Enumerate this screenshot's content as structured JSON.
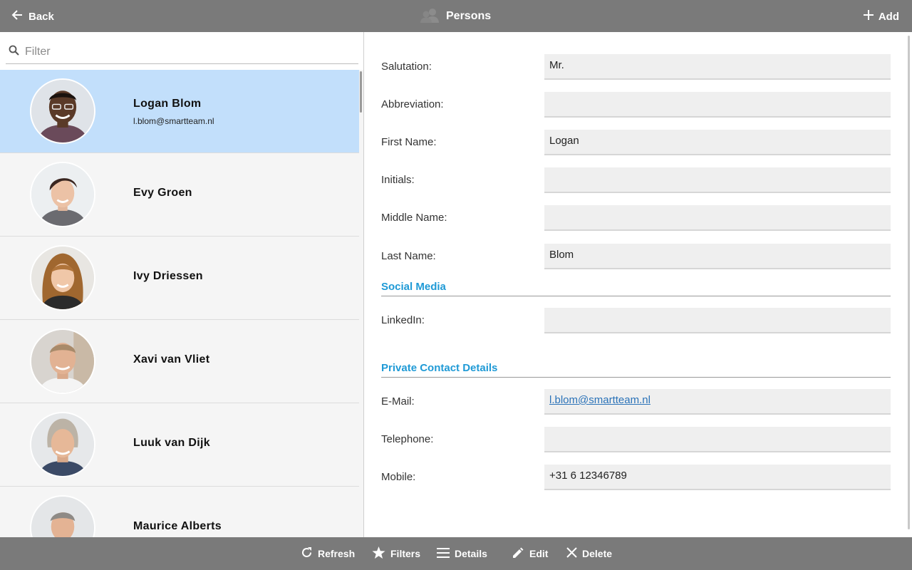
{
  "header": {
    "back_label": "Back",
    "title": "Persons",
    "add_label": "Add"
  },
  "filter": {
    "placeholder": "Filter",
    "value": ""
  },
  "persons": [
    {
      "name": "Logan Blom",
      "email": "l.blom@smartteam.nl",
      "selected": true
    },
    {
      "name": "Evy Groen",
      "email": "",
      "selected": false
    },
    {
      "name": "Ivy Driessen",
      "email": "",
      "selected": false
    },
    {
      "name": "Xavi van Vliet",
      "email": "",
      "selected": false
    },
    {
      "name": "Luuk van Dijk",
      "email": "",
      "selected": false
    },
    {
      "name": "Maurice Alberts",
      "email": "",
      "selected": false
    }
  ],
  "details": {
    "salutation": {
      "label": "Salutation:",
      "value": "Mr."
    },
    "abbreviation": {
      "label": "Abbreviation:",
      "value": ""
    },
    "first_name": {
      "label": "First Name:",
      "value": "Logan"
    },
    "initials": {
      "label": "Initials:",
      "value": ""
    },
    "middle_name": {
      "label": "Middle Name:",
      "value": ""
    },
    "last_name": {
      "label": "Last Name:",
      "value": "Blom"
    },
    "social_section": "Social Media",
    "linkedin": {
      "label": "LinkedIn:",
      "value": ""
    },
    "private_section": "Private Contact Details",
    "email": {
      "label": "E-Mail:",
      "value": "l.blom@smartteam.nl"
    },
    "telephone": {
      "label": "Telephone:",
      "value": ""
    },
    "mobile": {
      "label": "Mobile:",
      "value": "+31 6 12346789"
    }
  },
  "toolbar": {
    "refresh": "Refresh",
    "filters": "Filters",
    "details": "Details",
    "edit": "Edit",
    "delete": "Delete"
  },
  "colors": {
    "bar": "#7a7a7a",
    "selected_row": "#c2dffb",
    "section_title": "#1f9ad6",
    "link": "#2a72b8"
  },
  "icons": {
    "back": "arrow-left-icon",
    "title": "persons-group-icon",
    "add": "plus-icon",
    "filter": "search-icon",
    "refresh": "refresh-icon",
    "filters": "star-icon",
    "details": "list-icon",
    "edit": "pencil-icon",
    "delete": "close-icon"
  }
}
